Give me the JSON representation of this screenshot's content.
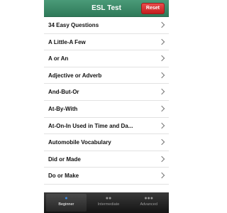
{
  "header": {
    "title": "ESL Test",
    "reset_label": "Reset"
  },
  "list": {
    "items": [
      {
        "label": "34 Easy Questions"
      },
      {
        "label": "A Little-A Few"
      },
      {
        "label": "A or An"
      },
      {
        "label": "Adjective or Adverb"
      },
      {
        "label": "And-But-Or"
      },
      {
        "label": "At-By-With"
      },
      {
        "label": "At-On-In Used in Time and Da..."
      },
      {
        "label": "Automobile Vocabulary"
      },
      {
        "label": "Did or Made"
      },
      {
        "label": "Do or Make"
      }
    ]
  },
  "tabbar": {
    "tabs": [
      {
        "label": "Beginner",
        "icon": "dot-icon",
        "active": true
      },
      {
        "label": "Intermediate",
        "icon": "two-dots-icon",
        "active": false
      },
      {
        "label": "Advanced",
        "icon": "three-dots-icon",
        "active": false
      }
    ]
  },
  "colors": {
    "navbar": "#2f7a59",
    "reset": "#c41e1e",
    "tabbar": "#141414",
    "active_tab_icon": "#3b8ee8"
  }
}
